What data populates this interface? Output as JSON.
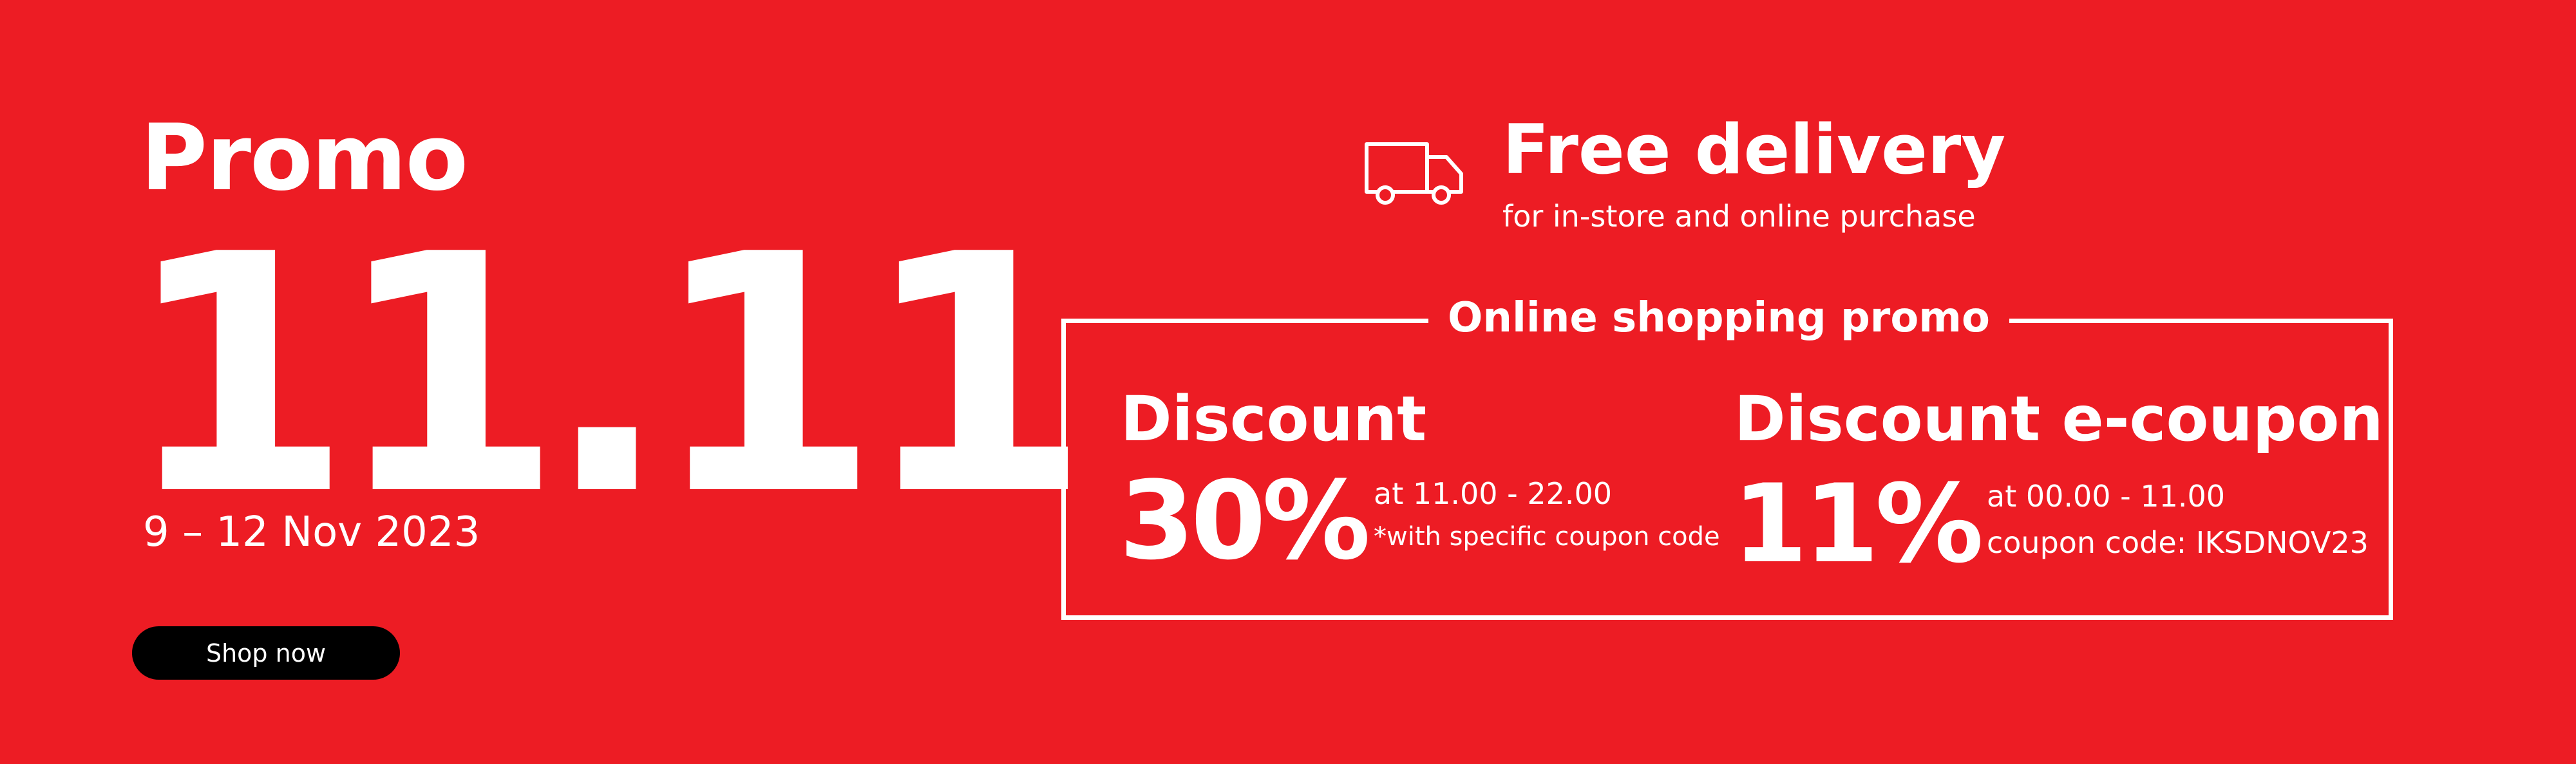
{
  "banner": {
    "background_color": "#ED1C24",
    "text_color": "#FFFFFF",
    "promo_label": "Promo",
    "big_date": "11.11",
    "date_range": "9 – 12 Nov 2023",
    "shop_button_label": "Shop now",
    "shop_button_color": "#000000"
  },
  "delivery": {
    "icon": "truck-icon",
    "title": "Free delivery",
    "subtitle": "for in-store and online purchase"
  },
  "online_promo": {
    "title": "Online shopping promo",
    "discounts": [
      {
        "title": "Discount",
        "amount": "30%",
        "time": "at 11.00 - 22.00",
        "note": "*with specific coupon code"
      },
      {
        "title": "Discount e-coupon",
        "amount": "11%",
        "time": "at 00.00 - 11.00",
        "note": "coupon code: IKSDNOV23"
      }
    ]
  }
}
